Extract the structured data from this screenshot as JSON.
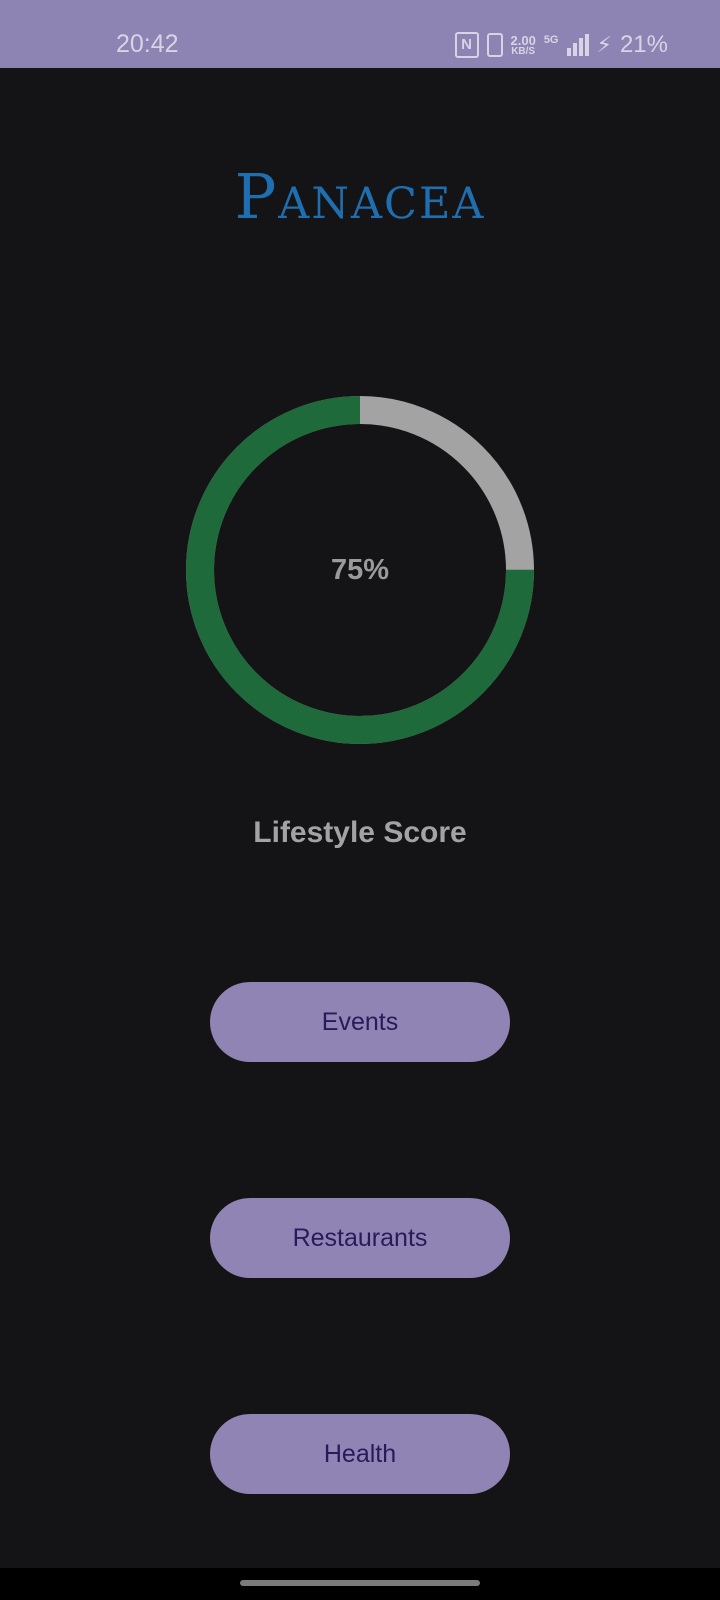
{
  "status_bar": {
    "time": "20:42",
    "nfc_label": "N",
    "speed_value": "2.00",
    "speed_unit": "KB/S",
    "network": "5G",
    "battery_text": "21%",
    "background_color": "#8d84b3"
  },
  "app": {
    "title": "Panacea",
    "title_color": "#1f6fb0"
  },
  "lifestyle": {
    "progress": 75,
    "progress_text": "75%",
    "label": "Lifestyle Score",
    "progress_color": "#1e6a3b",
    "track_color": "#a3a3a3"
  },
  "buttons": {
    "events": "Events",
    "restaurants": "Restaurants",
    "health": "Health",
    "color": "#8f84b3"
  }
}
